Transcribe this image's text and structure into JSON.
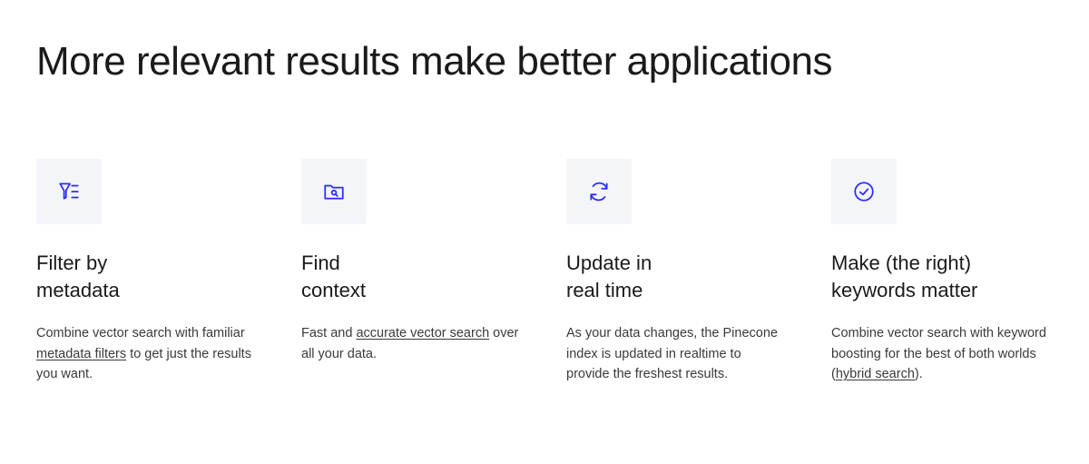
{
  "heading": "More relevant results make\nbetter applications",
  "features": [
    {
      "icon": "filter-icon",
      "title": "Filter by\nmetadata",
      "desc_parts": [
        {
          "text": "Combine vector search with familiar "
        },
        {
          "text": "metadata filters",
          "link": true
        },
        {
          "text": " to get just the results you want."
        }
      ]
    },
    {
      "icon": "folder-search-icon",
      "title": "Find\ncontext",
      "desc_parts": [
        {
          "text": "Fast and "
        },
        {
          "text": "accurate vector search",
          "link": true
        },
        {
          "text": " over all your data."
        }
      ]
    },
    {
      "icon": "refresh-icon",
      "title": "Update in\nreal time",
      "desc_parts": [
        {
          "text": "As your data changes, the Pinecone index is updated in realtime to provide the freshest results."
        }
      ]
    },
    {
      "icon": "check-circle-icon",
      "title": "Make (the right)\nkeywords matter",
      "desc_parts": [
        {
          "text": "Combine vector search with keyword boosting for the best of both worlds ("
        },
        {
          "text": "hybrid search",
          "link": true
        },
        {
          "text": ")."
        }
      ]
    }
  ],
  "colors": {
    "icon": "#2b2bff"
  }
}
